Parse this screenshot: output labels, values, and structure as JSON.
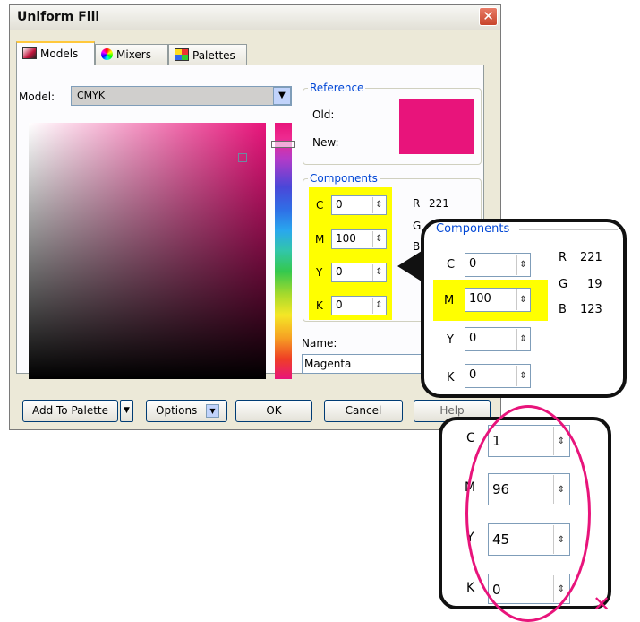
{
  "dialog": {
    "title": "Uniform Fill",
    "close_glyph": "✕",
    "tabs": [
      {
        "label": "Models",
        "icon": "models-tab-icon"
      },
      {
        "label": "Mixers",
        "icon": "mixers-tab-icon"
      },
      {
        "label": "Palettes",
        "icon": "palettes-tab-icon"
      }
    ],
    "model_label": "Model:",
    "model_value": "CMYK",
    "reference": {
      "legend": "Reference",
      "old_label": "Old:",
      "new_label": "New:",
      "swatch_color": "#e8147b"
    },
    "components": {
      "legend": "Components",
      "cmyk": [
        {
          "label": "C",
          "value": "0"
        },
        {
          "label": "M",
          "value": "100"
        },
        {
          "label": "Y",
          "value": "0"
        },
        {
          "label": "K",
          "value": "0"
        }
      ],
      "rgb": [
        {
          "label": "R",
          "value": "221"
        },
        {
          "label": "G",
          "value": "19"
        },
        {
          "label": "B",
          "value": "123"
        }
      ],
      "partial_rgb": [
        {
          "label": "R",
          "value": "221"
        },
        {
          "label": "G",
          "value": "19"
        },
        {
          "label": "B",
          "value": ""
        }
      ]
    },
    "name_label": "Name:",
    "name_value": "Magenta",
    "buttons": {
      "add_to_palette": "Add To Palette",
      "options": "Options",
      "ok": "OK",
      "cancel": "Cancel",
      "help": "Help"
    }
  },
  "callout_components": {
    "legend": "Components",
    "cmyk": [
      {
        "label": "C",
        "value": "0"
      },
      {
        "label": "M",
        "value": "100"
      },
      {
        "label": "Y",
        "value": "0"
      },
      {
        "label": "K",
        "value": "0"
      }
    ],
    "rgb": [
      {
        "label": "R",
        "value": "221"
      },
      {
        "label": "G",
        "value": "19"
      },
      {
        "label": "B",
        "value": "123"
      }
    ]
  },
  "callout_wrong": {
    "cmyk": [
      {
        "label": "C",
        "value": "1"
      },
      {
        "label": "M",
        "value": "96"
      },
      {
        "label": "Y",
        "value": "45"
      },
      {
        "label": "K",
        "value": "0"
      }
    ],
    "mark": "✕"
  },
  "colors": {
    "accent_magenta": "#e8147b",
    "highlight_yellow": "#ffff00",
    "legend_blue": "#0046d5",
    "dialog_bg": "#ece9d8"
  }
}
